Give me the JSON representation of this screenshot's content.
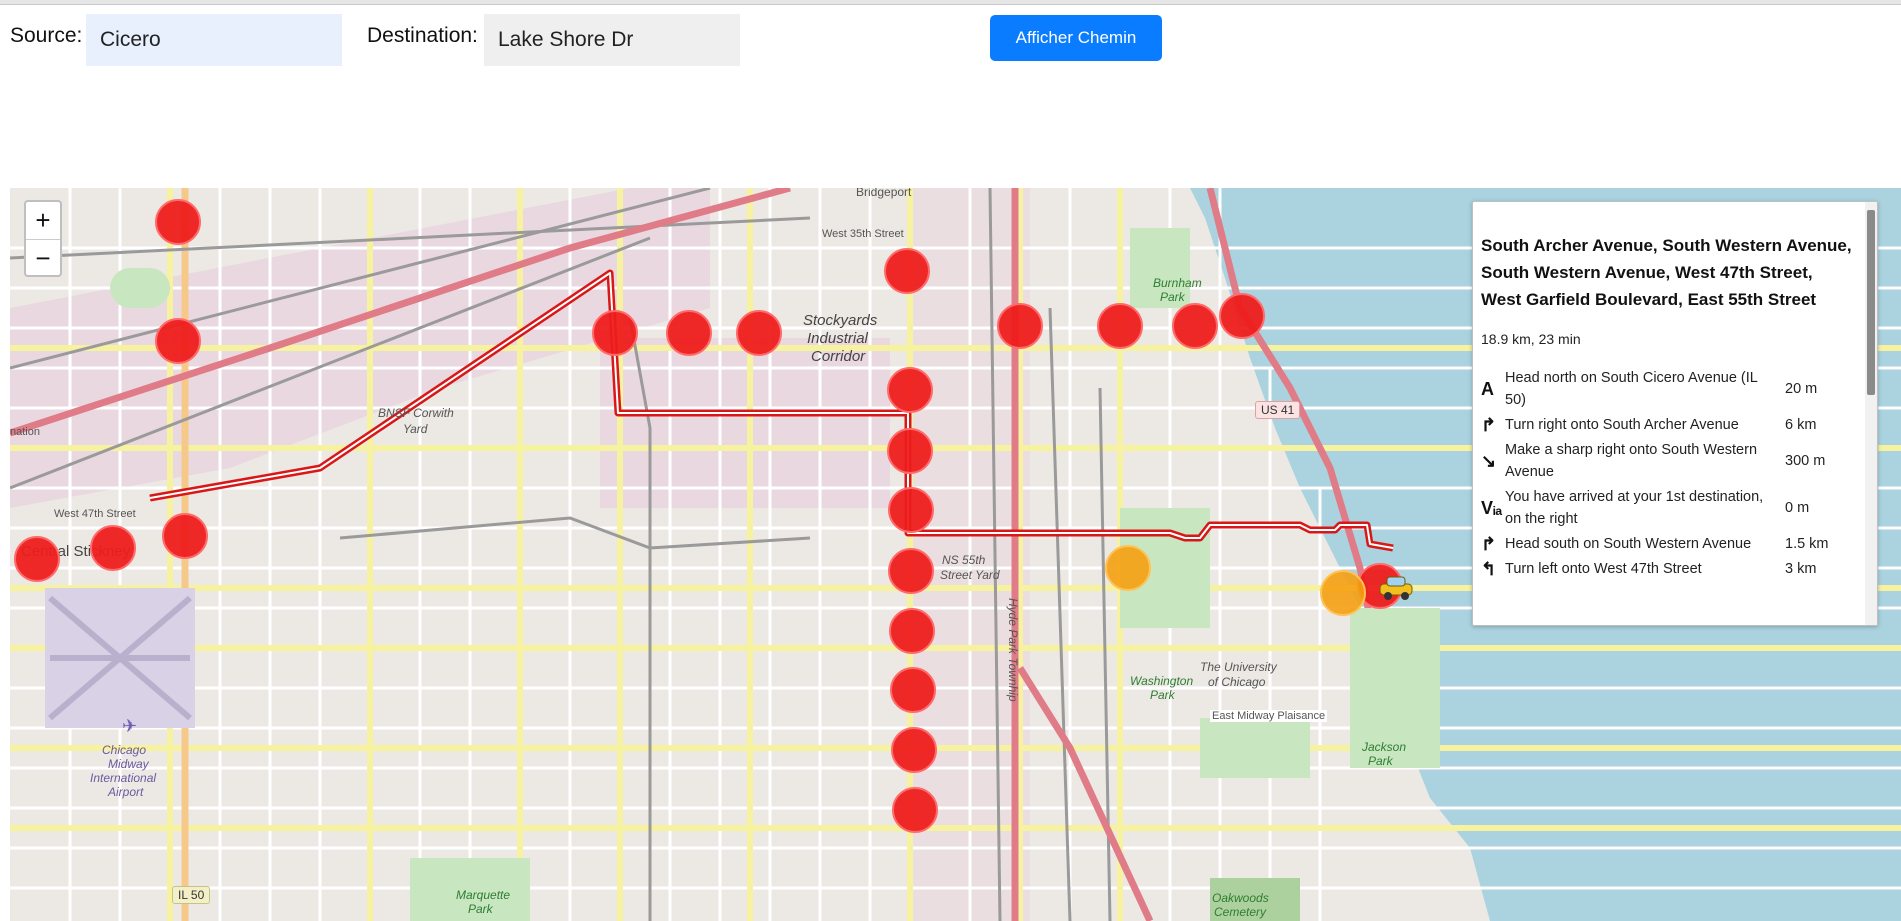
{
  "form": {
    "source_label": "Source:",
    "source_value": "Cicero",
    "destination_label": "Destination:",
    "destination_value": "Lake Shore Dr",
    "submit_label": "Afficher Chemin"
  },
  "map": {
    "zoom_in": "+",
    "zoom_out": "−",
    "labels": {
      "bridgeport": "Bridgeport",
      "west35": "West 35th Street",
      "stockyards1": "Stockyards",
      "stockyards2": "Industrial",
      "stockyards3": "Corridor",
      "bnsf1": "BNSF Corwith",
      "bnsf2": "Yard",
      "west47": "West 47th Street",
      "stickney": "Central Stickney",
      "nsyard1": "NS 55th",
      "nsyard2": "Street Yard",
      "hydepark": "Hyde Park Townhip",
      "burnham1": "Burnham",
      "burnham2": "Park",
      "washington1": "Washington",
      "washington2": "Park",
      "uchicago1": "The University",
      "uchicago2": "of Chicago",
      "midway": "East Midway Plaisance",
      "jackson1": "Jackson",
      "jackson2": "Park",
      "marquette1": "Marquette",
      "marquette2": "Park",
      "oakwoods1": "Oakwoods",
      "oakwoods2": "Cemetery",
      "airport1": "Chicago",
      "airport2": "Midway",
      "airport3": "International",
      "airport4": "Airport",
      "nation": "nation"
    },
    "shields": {
      "us41": "US 41",
      "il50": "IL 50"
    }
  },
  "route_panel": {
    "title": "South Archer Avenue, South Western Avenue, South Western Avenue, West 47th Street, West Garfield Boulevard, East 55th Street",
    "summary": "18.9 km, 23 min",
    "steps": [
      {
        "icon": "A",
        "text": "Head north on South Cicero Avenue (IL 50)",
        "distance": "20 m"
      },
      {
        "icon": "↱",
        "text": "Turn right onto South Archer Avenue",
        "distance": "6 km"
      },
      {
        "icon": "↘",
        "text": "Make a sharp right onto South Western Avenue",
        "distance": "300 m"
      },
      {
        "icon": "Vᵢₐ",
        "text": "You have arrived at your 1st destination, on the right",
        "distance": "0 m"
      },
      {
        "icon": "↱",
        "text": "Head south on South Western Avenue",
        "distance": "1.5 km"
      },
      {
        "icon": "↰",
        "text": "Turn left onto West 47th Street",
        "distance": "3 km"
      }
    ]
  },
  "colors": {
    "accent": "#0a7cff",
    "marker_red": "#ee1c1c",
    "marker_orange": "#f5a011",
    "route": "#d81818",
    "water": "#aad3df"
  }
}
